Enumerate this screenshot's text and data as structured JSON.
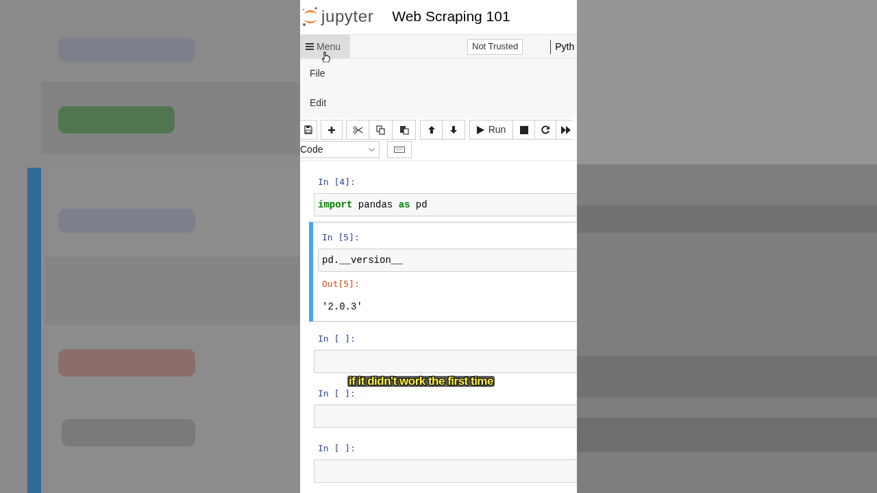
{
  "header": {
    "logo_text": "jupyter",
    "notebook_title": "Web Scraping 101"
  },
  "menubar": {
    "menu_label": "Menu",
    "menu_hovered": true,
    "trusted_label": "Not Trusted",
    "kernel_label": "Pyth"
  },
  "menu_items": [
    {
      "label": "File"
    },
    {
      "label": "Edit"
    }
  ],
  "toolbar": {
    "run_label": "Run",
    "cell_type": "Code"
  },
  "cells": [
    {
      "prompt": "In [4]:",
      "selected": false,
      "source": [
        {
          "text": "import",
          "kind": "keyword"
        },
        {
          "text": " pandas ",
          "kind": "plain"
        },
        {
          "text": "as",
          "kind": "keyword"
        },
        {
          "text": " pd",
          "kind": "plain"
        }
      ]
    },
    {
      "prompt": "In [5]:",
      "selected": true,
      "source": [
        {
          "text": "pd.__version__",
          "kind": "plain"
        }
      ],
      "output_prompt": "Out[5]:",
      "output": "'2.0.3'"
    },
    {
      "prompt": "In [ ]:",
      "selected": false
    },
    {
      "prompt": "In [ ]:",
      "selected": false
    },
    {
      "prompt": "In [ ]:",
      "selected": false
    }
  ],
  "caption": "if it didn't work the first time"
}
